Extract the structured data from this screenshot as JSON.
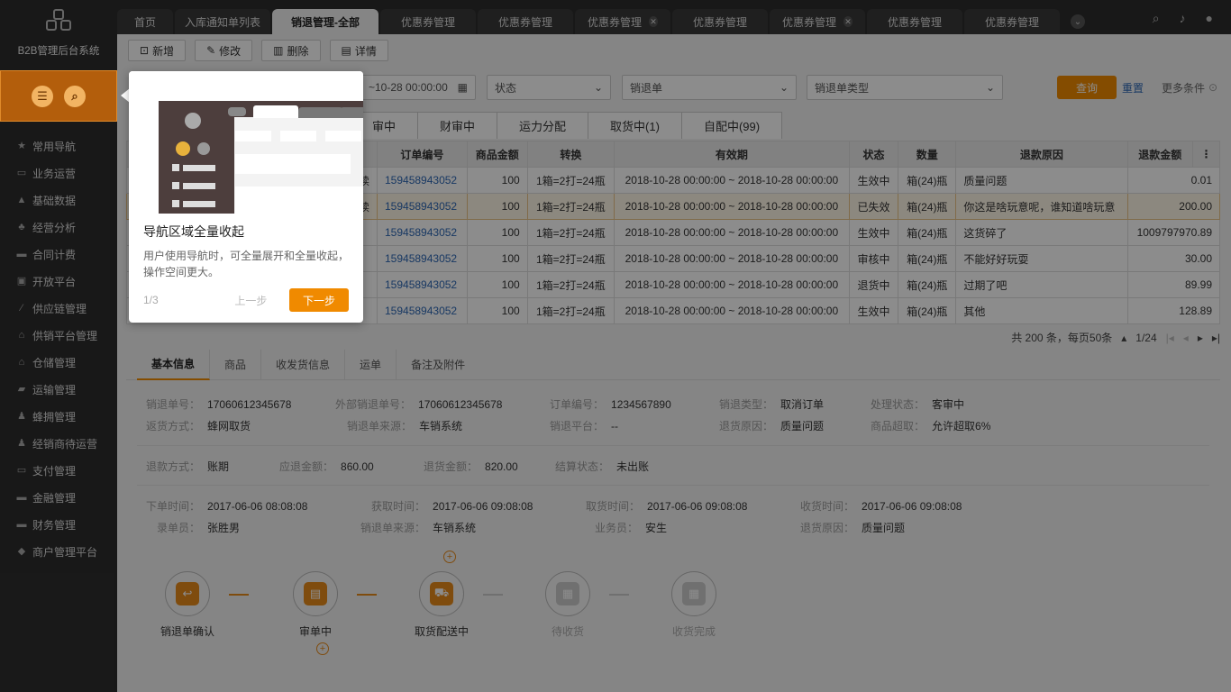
{
  "app": {
    "title": "B2B管理后台系统"
  },
  "tabs": [
    {
      "label": "首页",
      "closable": false,
      "active": false
    },
    {
      "label": "入库通知单列表",
      "closable": false,
      "active": false
    },
    {
      "label": "销退管理-全部",
      "closable": false,
      "active": true
    },
    {
      "label": "优惠券管理",
      "closable": false,
      "active": false
    },
    {
      "label": "优惠券管理",
      "closable": false,
      "active": false
    },
    {
      "label": "优惠券管理",
      "closable": true,
      "active": false
    },
    {
      "label": "优惠券管理",
      "closable": false,
      "active": false
    },
    {
      "label": "优惠券管理",
      "closable": true,
      "active": false
    },
    {
      "label": "优惠券管理",
      "closable": false,
      "active": false
    },
    {
      "label": "优惠券管理",
      "closable": false,
      "active": false
    }
  ],
  "sidebar": {
    "items": [
      {
        "label": "常用导航",
        "icon": "star-icon"
      },
      {
        "label": "业务运营",
        "icon": "monitor-icon"
      },
      {
        "label": "基础数据",
        "icon": "chart-icon"
      },
      {
        "label": "经营分析",
        "icon": "org-icon"
      },
      {
        "label": "合同计费",
        "icon": "folder-icon"
      },
      {
        "label": "开放平台",
        "icon": "window-icon"
      },
      {
        "label": "供应链管理",
        "icon": "link-icon"
      },
      {
        "label": "供销平台管理",
        "icon": "home-icon"
      },
      {
        "label": "仓储管理",
        "icon": "warehouse-icon"
      },
      {
        "label": "运输管理",
        "icon": "truck-icon"
      },
      {
        "label": "蜂拥管理",
        "icon": "people-icon"
      },
      {
        "label": "经销商待运营",
        "icon": "group-icon"
      },
      {
        "label": "支付管理",
        "icon": "wallet-icon"
      },
      {
        "label": "金融管理",
        "icon": "bank-icon"
      },
      {
        "label": "财务管理",
        "icon": "ledger-icon"
      },
      {
        "label": "商户管理平台",
        "icon": "layers-icon"
      }
    ]
  },
  "toolbar": {
    "new": "新增",
    "edit": "修改",
    "delete": "删除",
    "detail": "详情"
  },
  "filters": {
    "date_value": "~10-28 00:00:00",
    "status_label": "状态",
    "order_label": "销退单",
    "order_type_label": "销退单类型",
    "query": "查询",
    "reset": "重置",
    "more": "更多条件"
  },
  "subtabs": [
    "审中",
    "财审中",
    "运力分配",
    "取货中(1)",
    "自配中(99)"
  ],
  "table": {
    "headers": [
      "",
      "订单编号",
      "商品金额",
      "转换",
      "有效期",
      "状态",
      "数量",
      "退款原因",
      "退款金额"
    ],
    "rows": [
      {
        "prefix": "续",
        "order": "159458943052",
        "amount": "100",
        "conv": "1箱=2打=24瓶",
        "validity": "2018-10-28 00:00:00 ~ 2018-10-28 00:00:00",
        "status": "生效中",
        "qty": "箱(24)瓶",
        "reason": "质量问题",
        "refund": "0.01"
      },
      {
        "prefix": "续",
        "order": "159458943052",
        "amount": "100",
        "conv": "1箱=2打=24瓶",
        "validity": "2018-10-28 00:00:00 ~ 2018-10-28 00:00:00",
        "status": "已失效",
        "qty": "箱(24)瓶",
        "reason": "你这是啥玩意呢，谁知道啥玩意",
        "refund": "200.00"
      },
      {
        "prefix": "",
        "order": "159458943052",
        "amount": "100",
        "conv": "1箱=2打=24瓶",
        "validity": "2018-10-28 00:00:00 ~ 2018-10-28 00:00:00",
        "status": "生效中",
        "qty": "箱(24)瓶",
        "reason": "这货碎了",
        "refund": "1009797970.89"
      },
      {
        "prefix": "",
        "order": "159458943052",
        "amount": "100",
        "conv": "1箱=2打=24瓶",
        "validity": "2018-10-28 00:00:00 ~ 2018-10-28 00:00:00",
        "status": "审核中",
        "qty": "箱(24)瓶",
        "reason": "不能好好玩耍",
        "refund": "30.00"
      },
      {
        "prefix": "",
        "order": "159458943052",
        "amount": "100",
        "conv": "1箱=2打=24瓶",
        "validity": "2018-10-28 00:00:00 ~ 2018-10-28 00:00:00",
        "status": "退货中",
        "qty": "箱(24)瓶",
        "reason": "过期了吧",
        "refund": "89.99"
      },
      {
        "prefix": "",
        "order": "159458943052",
        "amount": "100",
        "conv": "1箱=2打=24瓶",
        "validity": "2018-10-28 00:00:00 ~ 2018-10-28 00:00:00",
        "status": "生效中",
        "qty": "箱(24)瓶",
        "reason": "其他",
        "refund": "128.89"
      }
    ]
  },
  "pager": {
    "total": "共 200 条，每页50条",
    "page": "1/24"
  },
  "detail_tabs": [
    "基本信息",
    "商品",
    "收发货信息",
    "运单",
    "备注及附件"
  ],
  "detail": {
    "row1": [
      {
        "k": "销退单号：",
        "v": "17060612345678"
      },
      {
        "k": "外部销退单号：",
        "v": "17060612345678"
      },
      {
        "k": "订单编号：",
        "v": "1234567890"
      },
      {
        "k": "销退类型：",
        "v": "取消订单"
      },
      {
        "k": "处理状态：",
        "v": "客审中"
      }
    ],
    "row2": [
      {
        "k": "返货方式：",
        "v": "蜂网取货"
      },
      {
        "k": "销退单来源：",
        "v": "车销系统"
      },
      {
        "k": "销退平台：",
        "v": "--"
      },
      {
        "k": "退货原因：",
        "v": "质量问题"
      },
      {
        "k": "商品超取：",
        "v": "允许超取6%"
      }
    ],
    "row3": [
      {
        "k": "退款方式：",
        "v": "账期"
      },
      {
        "k": "应退金额：",
        "v": "860.00"
      },
      {
        "k": "退货金额：",
        "v": "820.00"
      },
      {
        "k": "结算状态：",
        "v": "未出账"
      }
    ],
    "row4": [
      {
        "k": "下单时间：",
        "v": "2017-06-06 08:08:08"
      },
      {
        "k": "获取时间：",
        "v": "2017-06-06 09:08:08"
      },
      {
        "k": "取货时间：",
        "v": "2017-06-06 09:08:08"
      },
      {
        "k": "收货时间：",
        "v": "2017-06-06 09:08:08"
      }
    ],
    "row5": [
      {
        "k": "录单员：",
        "v": "张胜男"
      },
      {
        "k": "销退单来源：",
        "v": "车销系统"
      },
      {
        "k": "业务员：",
        "v": "安生"
      },
      {
        "k": "退货原因：",
        "v": "质量问题"
      }
    ]
  },
  "steps": [
    {
      "label": "销退单确认",
      "done": true
    },
    {
      "label": "审单中",
      "done": true
    },
    {
      "label": "取货配送中",
      "done": true
    },
    {
      "label": "待收货",
      "done": false
    },
    {
      "label": "收货完成",
      "done": false
    }
  ],
  "guide": {
    "title": "导航区域全量收起",
    "desc": "用户使用导航时，可全量展开和全量收起，操作空间更大。",
    "count": "1/3",
    "prev": "上一步",
    "next": "下一步"
  },
  "colors": {
    "accent": "#f08a00",
    "sidebar": "#2d2d2d",
    "link": "#2e68b5"
  }
}
